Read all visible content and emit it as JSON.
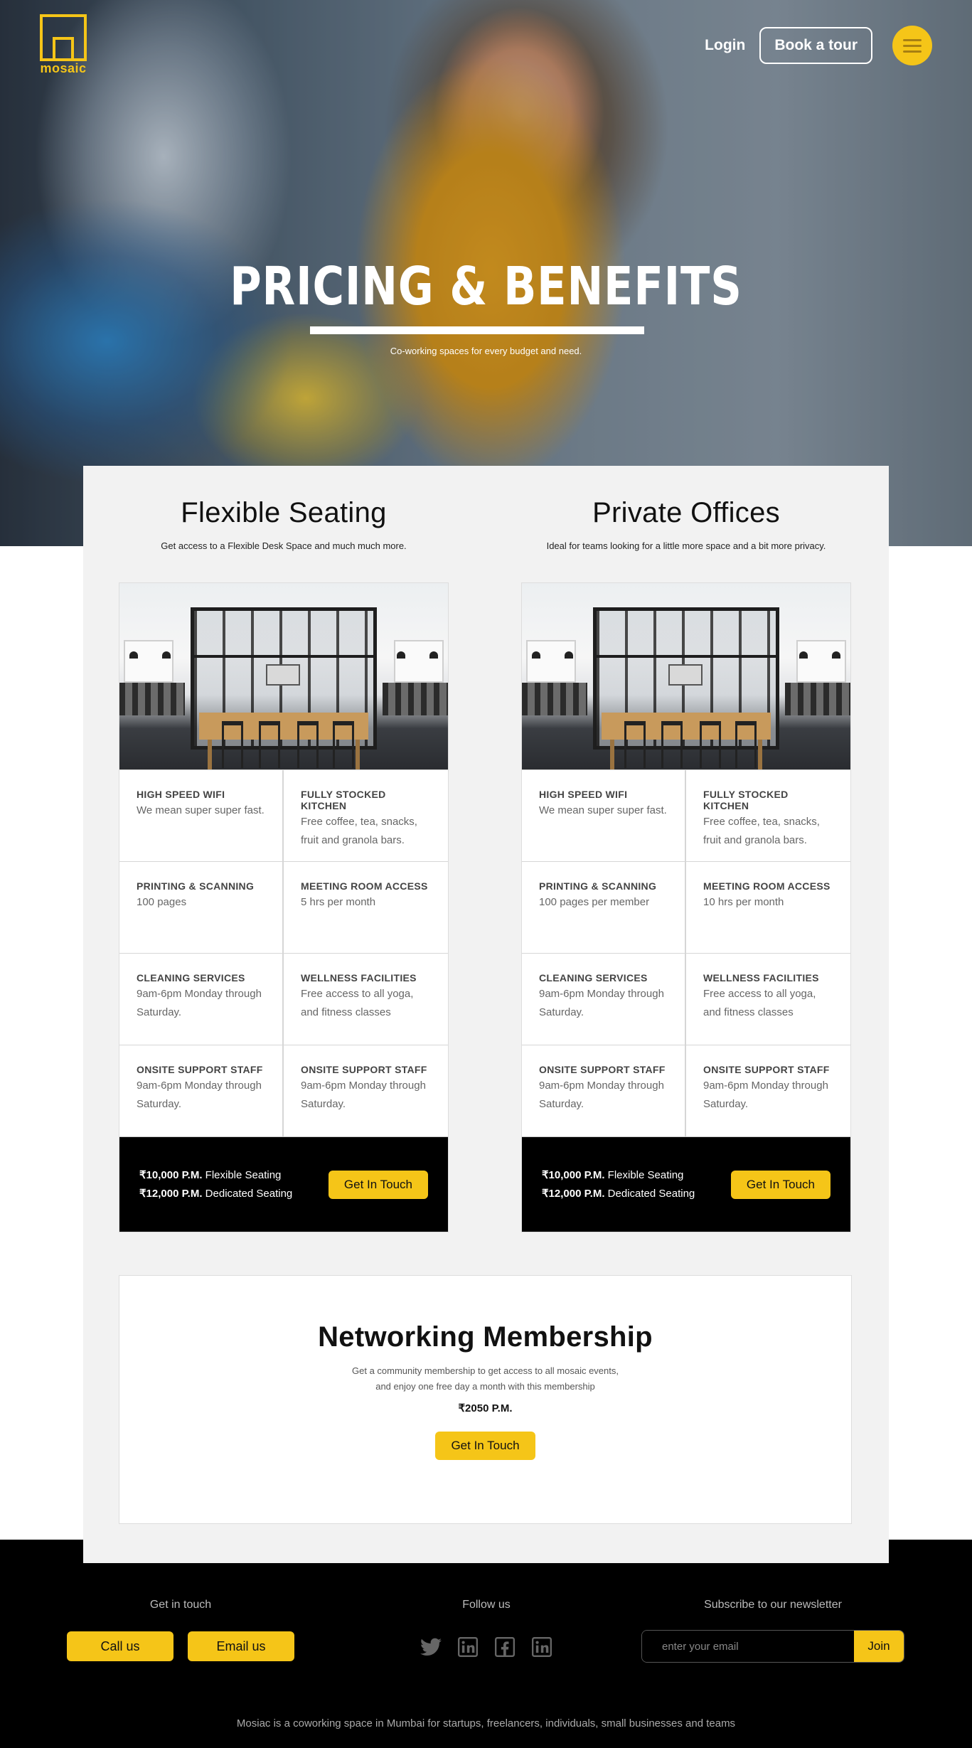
{
  "brand": {
    "logo_text": "mosaic"
  },
  "nav": {
    "login_label": "Login",
    "tour_label": "Book a tour",
    "menu_icon": "hamburger-icon"
  },
  "hero": {
    "title": "PRICING & BENEFITS",
    "subtitle": "Co-working spaces for every budget and need."
  },
  "plans": [
    {
      "title": "Flexible Seating",
      "subtitle": "Get access to a Flexible Desk Space and much much more.",
      "features": [
        {
          "title": "HIGH SPEED WIFI",
          "text": "We mean super super fast."
        },
        {
          "title": "FULLY STOCKED KITCHEN",
          "text": "Free coffee, tea, snacks, fruit and granola bars."
        },
        {
          "title": "PRINTING & SCANNING",
          "text": "100 pages"
        },
        {
          "title": "MEETING ROOM ACCESS",
          "text": "5 hrs per month"
        },
        {
          "title": "CLEANING SERVICES",
          "text": "9am-6pm Monday through Saturday."
        },
        {
          "title": "WELLNESS FACILITIES",
          "text": "Free access to all yoga, and fitness classes"
        },
        {
          "title": "ONSITE SUPPORT  STAFF",
          "text": "9am-6pm Monday through Saturday."
        },
        {
          "title": "ONSITE SUPPORT  STAFF",
          "text": "9am-6pm Monday through Saturday."
        }
      ],
      "price_1_amount": "₹10,000 P.M.",
      "price_1_label": "Flexible Seating",
      "price_2_amount": "₹12,000 P.M.",
      "price_2_label": "Dedicated Seating",
      "cta": "Get In Touch"
    },
    {
      "title": "Private Offices",
      "subtitle": "Ideal for teams looking for a little more space and a bit more privacy.",
      "features": [
        {
          "title": "HIGH SPEED WIFI",
          "text": "We mean super super fast."
        },
        {
          "title": "FULLY STOCKED KITCHEN",
          "text": "Free coffee, tea, snacks, fruit and granola bars."
        },
        {
          "title": "PRINTING & SCANNING",
          "text": "100 pages per member"
        },
        {
          "title": "MEETING ROOM ACCESS",
          "text": "10 hrs per month"
        },
        {
          "title": "CLEANING SERVICES",
          "text": "9am-6pm Monday through Saturday."
        },
        {
          "title": "WELLNESS FACILITIES",
          "text": "Free access to all yoga, and fitness classes"
        },
        {
          "title": "ONSITE SUPPORT  STAFF",
          "text": "9am-6pm Monday through Saturday."
        },
        {
          "title": "ONSITE SUPPORT  STAFF",
          "text": "9am-6pm Monday through Saturday."
        }
      ],
      "price_1_amount": "₹10,000 P.M.",
      "price_1_label": "Flexible Seating",
      "price_2_amount": "₹12,000 P.M.",
      "price_2_label": "Dedicated Seating",
      "cta": "Get In Touch"
    }
  ],
  "networking": {
    "title": "Networking Membership",
    "text_line_1": "Get a community membership to get access to all mosaic events,",
    "text_line_2": "and enjoy one free day a month with this membership",
    "price": "₹2050 P.M.",
    "cta": "Get In Touch"
  },
  "footer": {
    "contact_heading": "Get in touch",
    "call_label": "Call us",
    "email_label": "Email us",
    "follow_heading": "Follow us",
    "social_icons": [
      "twitter-icon",
      "linkedin-icon",
      "facebook-icon",
      "linkedin-icon"
    ],
    "newsletter_heading": "Subscribe to our newsletter",
    "email_placeholder": "enter your email",
    "join_label": "Join",
    "note": "Mosiac is a coworking space in Mumbai for startups, freelancers, individuals, small businesses and teams"
  },
  "colors": {
    "accent": "#f5c518",
    "dark": "#000000",
    "panel": "#f2f2f2"
  }
}
